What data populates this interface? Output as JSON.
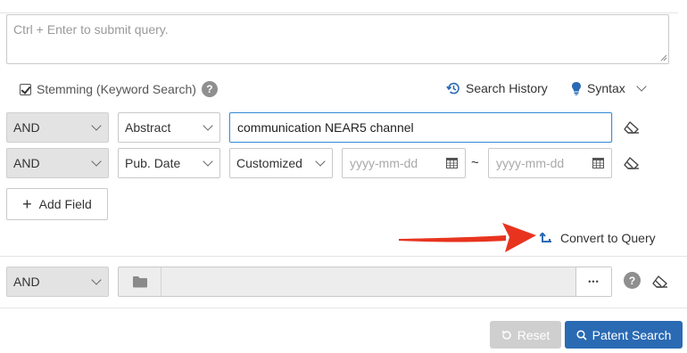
{
  "query": {
    "placeholder": "Ctrl + Enter to submit query."
  },
  "options": {
    "stemming_label": "Stemming (Keyword Search)",
    "stemming_checked": true,
    "help_glyph": "?",
    "search_history_label": "Search History",
    "syntax_label": "Syntax"
  },
  "rows": [
    {
      "operator": "AND",
      "field": "Abstract",
      "value": "communication NEAR5 channel"
    },
    {
      "operator": "AND",
      "field": "Pub. Date",
      "mode": "Customized",
      "from_placeholder": "yyyy-mm-dd",
      "separator": "~",
      "to_placeholder": "yyyy-mm-dd"
    }
  ],
  "add_field_label": "Add Field",
  "convert_label": "Convert to Query",
  "folder_row": {
    "operator": "AND",
    "dots": "•••"
  },
  "actions": {
    "reset_label": "Reset",
    "search_label": "Patent Search"
  },
  "colors": {
    "accent": "#2a6ab3",
    "arrow": "#e8341f",
    "focus": "#3d8fd8"
  }
}
